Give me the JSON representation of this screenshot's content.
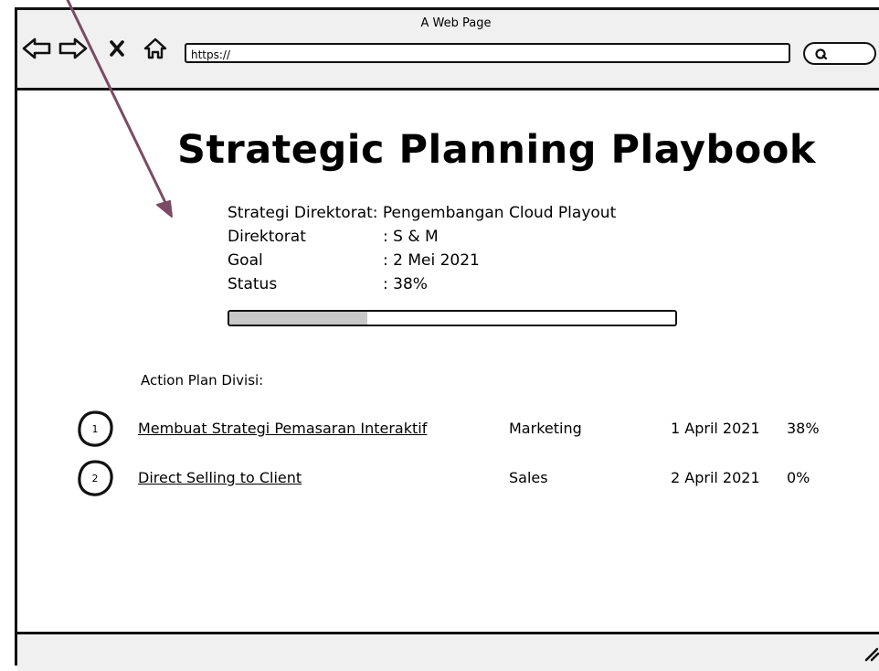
{
  "window": {
    "title": "A Web Page"
  },
  "browser": {
    "url": "https://"
  },
  "page": {
    "title": "Strategic Planning Playbook",
    "strategy": {
      "label": "Strategi Direktorat",
      "value": ": Pengembangan Cloud Playout"
    },
    "direktorat": {
      "label": "Direktorat",
      "value": ": S & M"
    },
    "goal": {
      "label": "Goal",
      "value": ": 2 Mei 2021"
    },
    "status": {
      "label": "Status",
      "value": ": 38%",
      "progress_fraction": 0.31
    }
  },
  "action_plan": {
    "label": "Action Plan Divisi:",
    "rows": [
      {
        "number": "1",
        "name": "Membuat Strategi Pemasaran Interaktif",
        "division": "Marketing",
        "date": "1 April 2021",
        "percent": "38%"
      },
      {
        "number": "2",
        "name": "Direct Selling to Client",
        "division": "Sales",
        "date": "2 April 2021",
        "percent": "0%"
      }
    ]
  },
  "colors": {
    "arrow": "#7a4b63",
    "progress_fill": "#c8c8c8",
    "chrome": "#f0f0f0"
  },
  "icons": [
    "back-arrow-icon",
    "forward-arrow-icon",
    "close-icon",
    "home-icon",
    "search-icon",
    "resize-grip-icon"
  ]
}
